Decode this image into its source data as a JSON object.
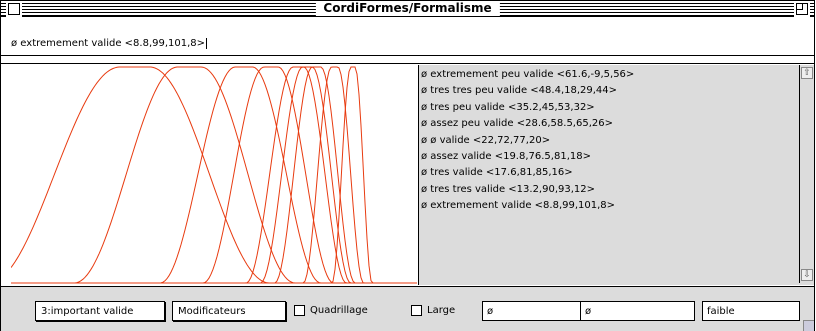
{
  "window": {
    "title": "CordiFormes/Formalisme"
  },
  "header": {
    "field_value": "ø extremement valide <8.8,99,101,8>"
  },
  "graph": {
    "curve_color": "#e83b10"
  },
  "list": {
    "items": [
      "ø extremement peu valide <61.6,-9,5,56>",
      "ø tres tres peu valide <48.4,18,29,44>",
      "ø tres peu valide <35.2,45,53,32>",
      "ø assez peu valide <28.6,58.5,65,26>",
      "ø ø valide <22,72,77,20>",
      "ø assez valide <19.8,76.5,81,18>",
      "ø tres valide <17.6,81,85,16>",
      "ø tres tres valide <13.2,90,93,12>",
      "ø extremement valide <8.8,99,101,8>"
    ]
  },
  "toolbar": {
    "mode_button": "3:important valide",
    "modifiers_button": "Modificateurs",
    "grid_checkbox": "Quadrillage",
    "large_checkbox": "Large",
    "field1": "ø",
    "field2": "ø",
    "field3": "faible"
  }
}
